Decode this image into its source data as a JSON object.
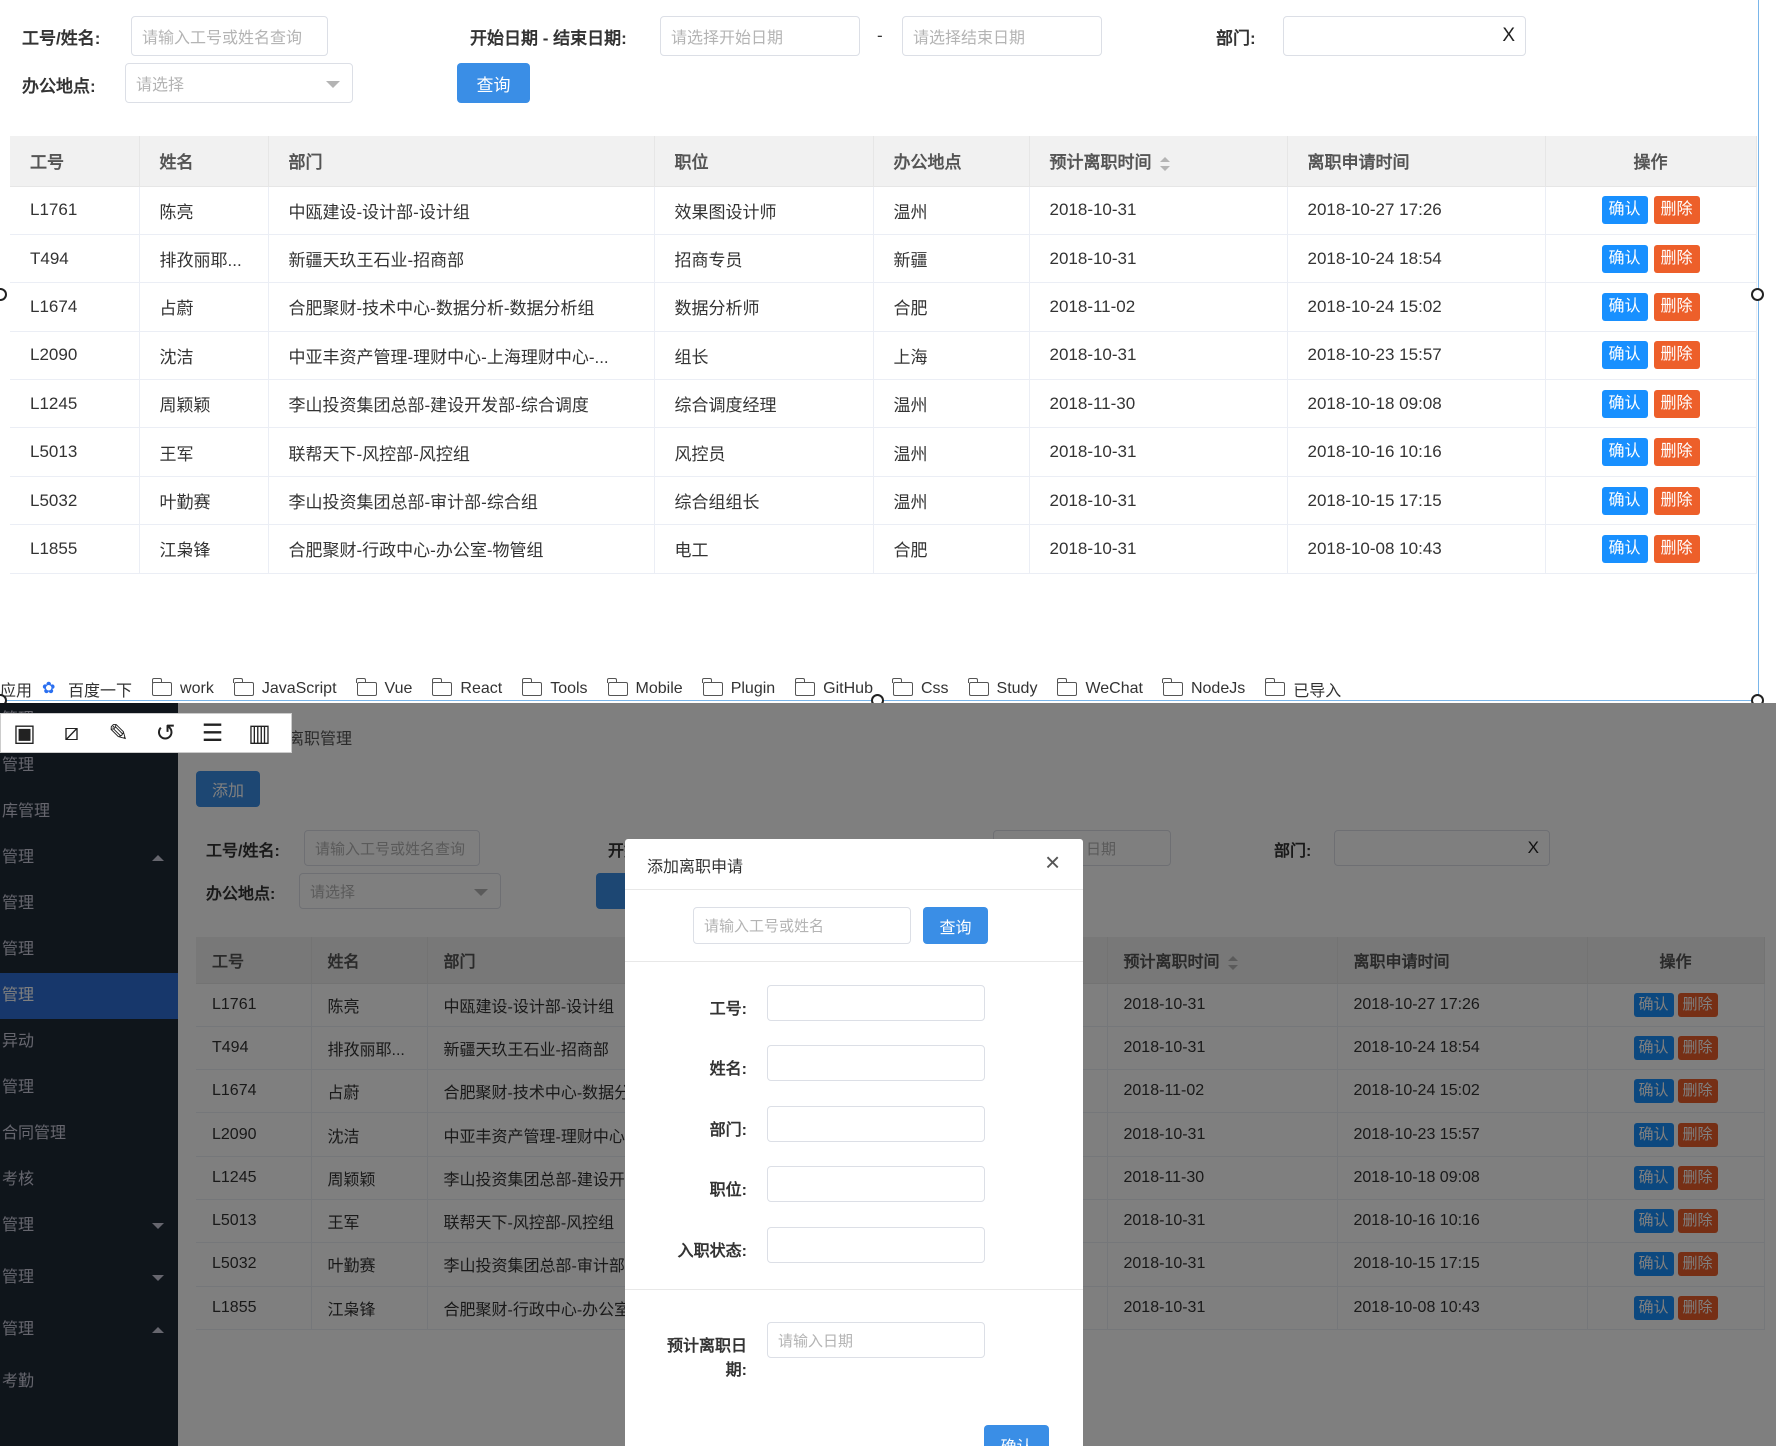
{
  "filters": {
    "id_name_label": "工号/姓名:",
    "id_name_placeholder": "请输入工号或姓名查询",
    "date_range_label": "开始日期 - 结束日期:",
    "start_date_placeholder": "请选择开始日期",
    "date_separator": "-",
    "end_date_placeholder": "请选择结束日期",
    "dept_label": "部门:",
    "dept_clear": "X",
    "office_label": "办公地点:",
    "office_placeholder": "请选择",
    "query_button": "查询"
  },
  "table": {
    "headers": [
      "工号",
      "姓名",
      "部门",
      "职位",
      "办公地点",
      "预计离职时间",
      "离职申请时间",
      "操作"
    ],
    "confirm_label": "确认",
    "delete_label": "删除",
    "rows": [
      {
        "id": "L1761",
        "name": "陈亮",
        "dept": "中瓯建设-设计部-设计组",
        "position": "效果图设计师",
        "office": "温州",
        "expected": "2018-10-31",
        "applied": "2018-10-27 17:26"
      },
      {
        "id": "T494",
        "name": "排孜丽耶...",
        "dept": "新疆天玖王石业-招商部",
        "position": "招商专员",
        "office": "新疆",
        "expected": "2018-10-31",
        "applied": "2018-10-24 18:54"
      },
      {
        "id": "L1674",
        "name": "占蔚",
        "dept": "合肥聚财-技术中心-数据分析-数据分析组",
        "position": "数据分析师",
        "office": "合肥",
        "expected": "2018-11-02",
        "applied": "2018-10-24 15:02"
      },
      {
        "id": "L2090",
        "name": "沈洁",
        "dept": "中亚丰资产管理-理财中心-上海理财中心-...",
        "position": "组长",
        "office": "上海",
        "expected": "2018-10-31",
        "applied": "2018-10-23 15:57"
      },
      {
        "id": "L1245",
        "name": "周颖颖",
        "dept": "李山投资集团总部-建设开发部-综合调度",
        "position": "综合调度经理",
        "office": "温州",
        "expected": "2018-11-30",
        "applied": "2018-10-18 09:08"
      },
      {
        "id": "L5013",
        "name": "王军",
        "dept": "联帮天下-风控部-风控组",
        "position": "风控员",
        "office": "温州",
        "expected": "2018-10-31",
        "applied": "2018-10-16 10:16"
      },
      {
        "id": "L5032",
        "name": "叶勤赛",
        "dept": "李山投资集团总部-审计部-综合组",
        "position": "综合组组长",
        "office": "温州",
        "expected": "2018-10-31",
        "applied": "2018-10-15 17:15"
      },
      {
        "id": "L1855",
        "name": "江枭锋",
        "dept": "合肥聚财-行政中心-办公室-物管组",
        "position": "电工",
        "office": "合肥",
        "expected": "2018-10-31",
        "applied": "2018-10-08 10:43"
      }
    ]
  },
  "bookmarks": {
    "apps": "应用",
    "items": [
      "百度一下",
      "work",
      "JavaScript",
      "Vue",
      "React",
      "Tools",
      "Mobile",
      "Plugin",
      "GitHub",
      "Css",
      "Study",
      "WeChat",
      "NodeJs",
      "已导入"
    ]
  },
  "bottom": {
    "breadcrumb": "离职管理",
    "add_button": "添加",
    "sidebar": [
      "管理",
      "管理",
      "库管理",
      "管理",
      "管理",
      "管理",
      "管理",
      "异动",
      "管理",
      "合同管理",
      "考核",
      "管理",
      "管理",
      "管理",
      "考勤"
    ],
    "table_headers": [
      "工号",
      "姓名",
      "部门",
      "预计离职时间",
      "离职申请时间",
      "操作"
    ],
    "filter_end_date_fragment": "日期"
  },
  "modal": {
    "title": "添加离职申请",
    "close": "×",
    "search_placeholder": "请输入工号或姓名",
    "search_button": "查询",
    "fields": [
      "工号:",
      "姓名:",
      "部门:",
      "职位:",
      "入职状态:"
    ],
    "date_label_line1": "预计离职日",
    "date_label_line2": "期:",
    "date_placeholder": "请输入日期",
    "confirm_button": "确认"
  },
  "colors": {
    "primary": "#3a8ee6",
    "confirm": "#1890ff",
    "delete": "#ed5f2a",
    "sidebar": "#1f2a37",
    "sidebar_active": "#2f6fd6"
  }
}
